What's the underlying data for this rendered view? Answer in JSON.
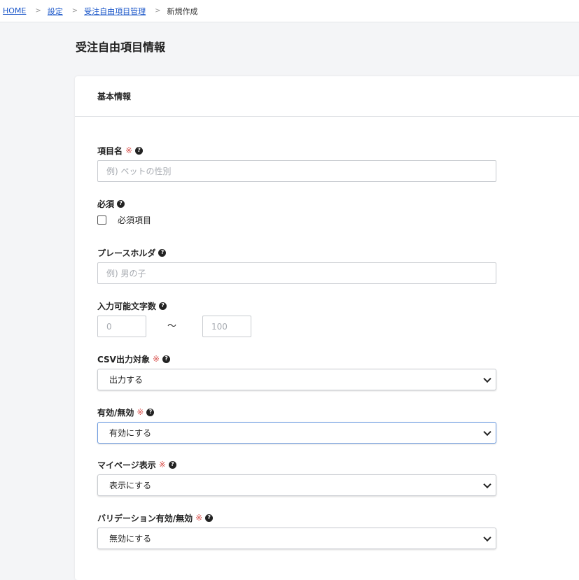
{
  "breadcrumb": {
    "home": "HOME",
    "settings": "設定",
    "custom_fields": "受注自由項目管理",
    "current": "新規作成",
    "separator": ">"
  },
  "page": {
    "title": "受注自由項目情報"
  },
  "card": {
    "header": "基本情報"
  },
  "form": {
    "required_mark": "※",
    "help_glyph": "?",
    "item_name": {
      "label": "項目名",
      "placeholder": "例) ペットの性別",
      "value": ""
    },
    "required": {
      "label": "必須",
      "checkbox_label": "必須項目",
      "checked": false
    },
    "placeholder_field": {
      "label": "プレースホルダ",
      "placeholder": "例) 男の子",
      "value": ""
    },
    "char_count": {
      "label": "入力可能文字数",
      "min_placeholder": "0",
      "max_placeholder": "100",
      "tilde": "〜"
    },
    "csv_output": {
      "label": "CSV出力対象",
      "selected": "出力する"
    },
    "active": {
      "label": "有効/無効",
      "selected": "有効にする"
    },
    "mypage_display": {
      "label": "マイページ表示",
      "selected": "表示にする"
    },
    "validation": {
      "label": "バリデーション有効/無効",
      "selected": "無効にする"
    }
  },
  "colors": {
    "link": "#1a56c9",
    "required_mark": "#d9534f",
    "focus_border": "#6b9ae0",
    "page_bg": "#f4f5f7"
  }
}
